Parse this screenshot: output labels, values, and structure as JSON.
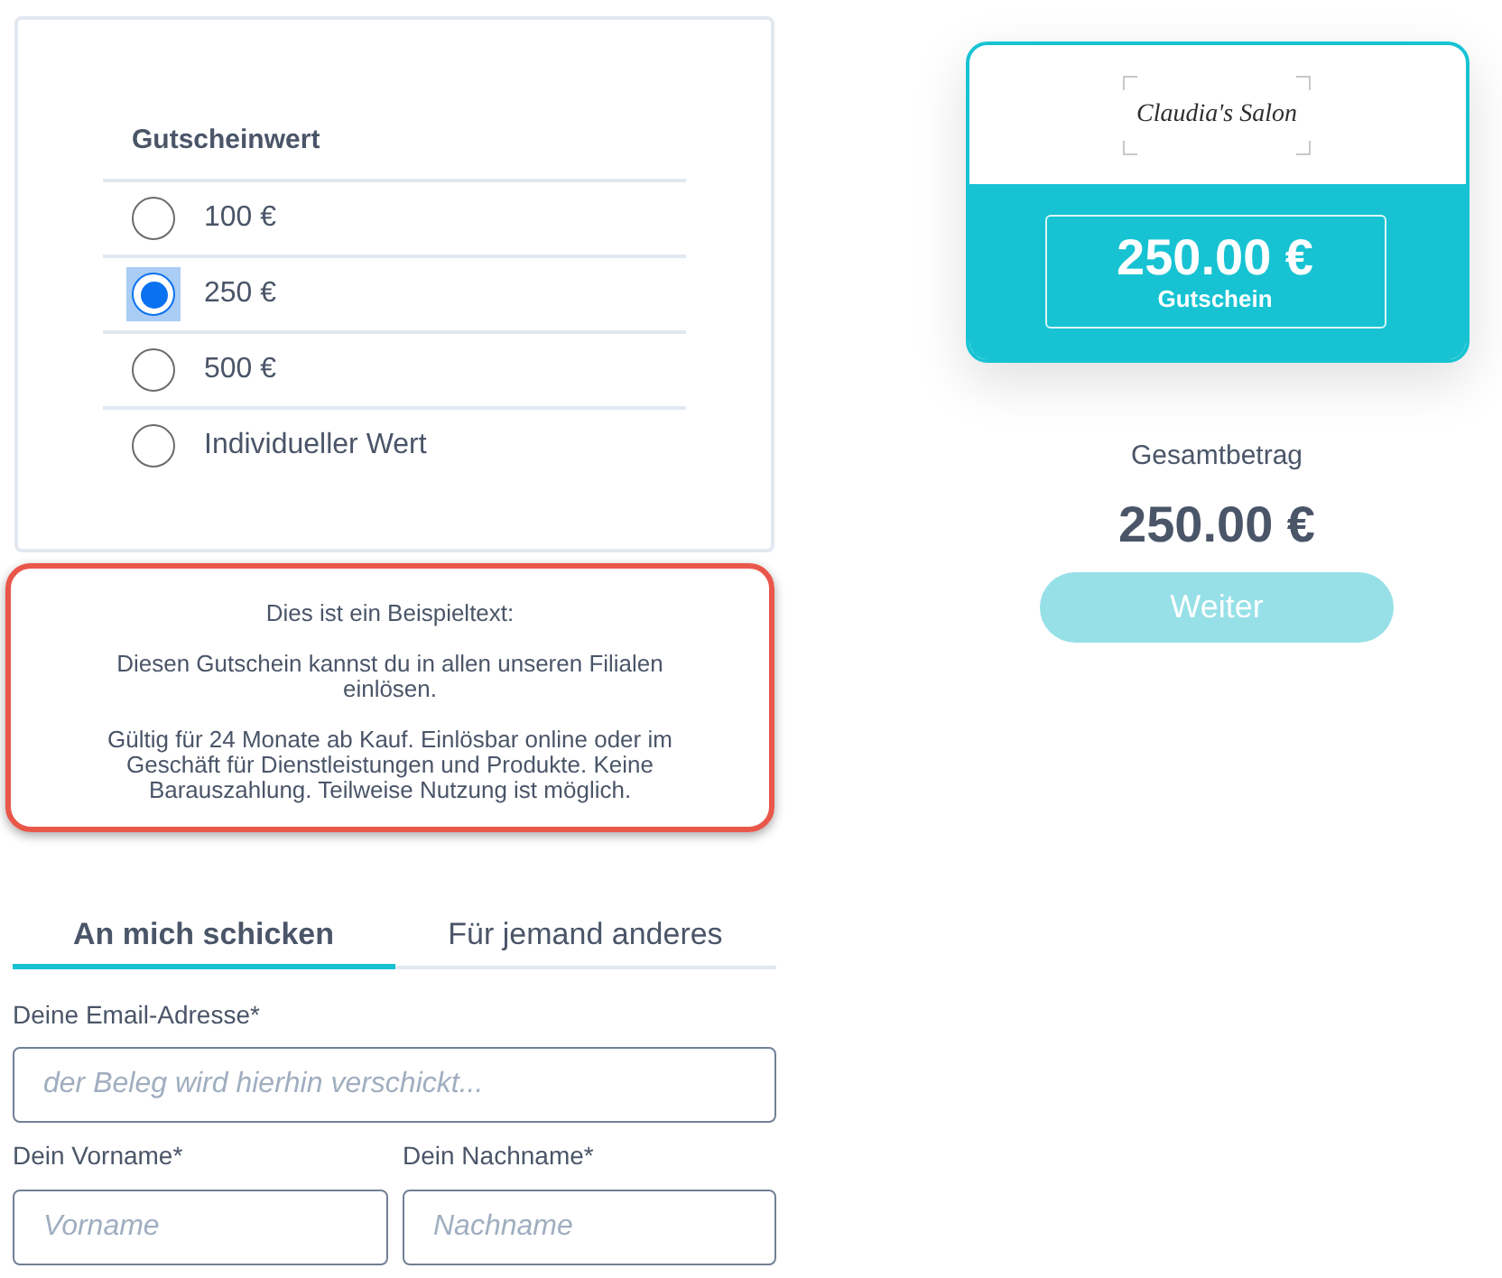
{
  "voucher_value": {
    "heading": "Gutscheinwert",
    "options": [
      {
        "label": "100 €",
        "selected": false
      },
      {
        "label": "250 €",
        "selected": true
      },
      {
        "label": "500 €",
        "selected": false
      },
      {
        "label": "Individueller Wert",
        "selected": false
      }
    ]
  },
  "description": {
    "highlighted": true,
    "paragraphs": [
      "Dies ist ein Beispieltext:",
      "Diesen Gutschein kannst du in allen unseren Filialen einlösen.",
      "Gültig für 24 Monate ab Kauf. Einlösbar online oder im Geschäft für Dienstleistungen und Produkte. Keine Barauszahlung. Teilweise Nutzung ist möglich."
    ]
  },
  "recipient_tabs": [
    {
      "label": "An mich schicken",
      "selected": true
    },
    {
      "label": "Für jemand anderes",
      "selected": false
    }
  ],
  "form": {
    "email": {
      "label": "Deine Email-Adresse*",
      "placeholder": "der Beleg wird hierhin verschickt..."
    },
    "name_row": [
      {
        "label": "Dein Vorname*",
        "placeholder": "Vorname"
      },
      {
        "label": "Dein Nachname*",
        "placeholder": "Nachname"
      }
    ]
  },
  "voucher_card": {
    "logo_text": "Claudia's Salon",
    "amount": "250.00 €",
    "caption": "Gutschein"
  },
  "summary": {
    "label": "Gesamtbetrag",
    "total": "250.00 €"
  },
  "next_button": {
    "label": "Weiter",
    "disabled": true
  }
}
